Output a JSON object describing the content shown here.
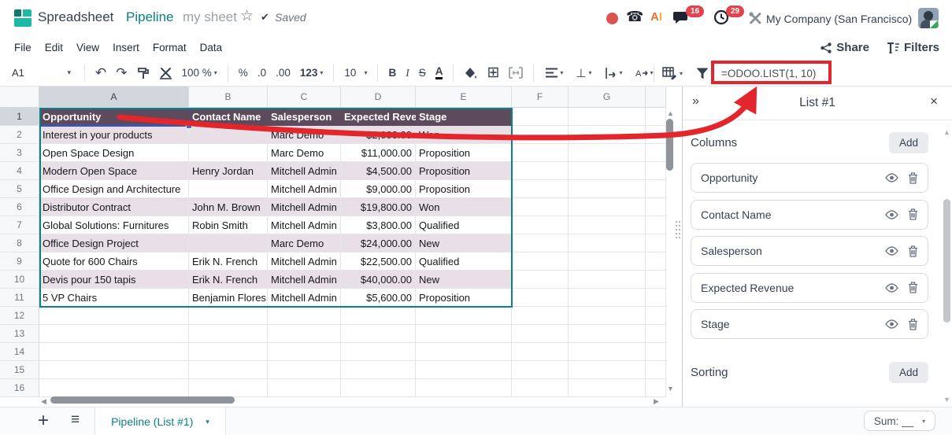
{
  "topbar": {
    "app_title": "Spreadsheet",
    "doc_title": "Pipeline",
    "doc_subtitle": "my sheet",
    "saved_label": "Saved",
    "company": "My Company (San Francisco)",
    "message_count": "16",
    "activity_count": "29"
  },
  "menubar": {
    "items": [
      "File",
      "Edit",
      "View",
      "Insert",
      "Format",
      "Data"
    ],
    "share_label": "Share",
    "filters_label": "Filters"
  },
  "toolbar": {
    "cell_ref": "A1",
    "zoom_label": "100 %",
    "percent_label": "%",
    "dec_less_label": ".0",
    "dec_more_label": ".00",
    "format_label": "123",
    "font_size": "10",
    "bold_label": "B",
    "italic_label": "I",
    "strike_label": "S",
    "color_label": "A",
    "formula": "=ODOO.LIST(1, 10)"
  },
  "grid": {
    "column_letters": [
      "A",
      "B",
      "C",
      "D",
      "E",
      "F",
      "G"
    ],
    "row_count": 16,
    "table": {
      "headers": [
        "Opportunity",
        "Contact Name",
        "Salesperson",
        "Expected Revenue",
        "Stage"
      ],
      "rows": [
        [
          "Interest in your products",
          "",
          "Marc Demo",
          "$2,000.00",
          "Won"
        ],
        [
          "Open Space Design",
          "",
          "Marc Demo",
          "$11,000.00",
          "Proposition"
        ],
        [
          "Modern Open Space",
          "Henry Jordan",
          "Mitchell Admin",
          "$4,500.00",
          "Proposition"
        ],
        [
          "Office Design and Architecture",
          "",
          "Mitchell Admin",
          "$9,000.00",
          "Proposition"
        ],
        [
          "Distributor Contract",
          "John M. Brown",
          "Mitchell Admin",
          "$19,800.00",
          "Won"
        ],
        [
          "Global Solutions: Furnitures",
          "Robin Smith",
          "Mitchell Admin",
          "$3,800.00",
          "Qualified"
        ],
        [
          "Office Design Project",
          "",
          "Marc Demo",
          "$24,000.00",
          "New"
        ],
        [
          "Quote for 600 Chairs",
          "Erik N. French",
          "Mitchell Admin",
          "$22,500.00",
          "Qualified"
        ],
        [
          "Devis pour 150 tapis",
          "Erik N. French",
          "Mitchell Admin",
          "$40,000.00",
          "New"
        ],
        [
          "5 VP Chairs",
          "Benjamin Flores",
          "Mitchell Admin",
          "$5,600.00",
          "Proposition"
        ]
      ]
    }
  },
  "panel": {
    "title": "List #1",
    "columns_section": {
      "label": "Columns",
      "add_label": "Add",
      "items": [
        "Opportunity",
        "Contact Name",
        "Salesperson",
        "Expected Revenue",
        "Stage"
      ]
    },
    "sorting_section": {
      "label": "Sorting",
      "add_label": "Add"
    }
  },
  "bottombar": {
    "sheet_tab": "Pipeline (List #1)",
    "sum_label": "Sum: __"
  },
  "icons": {
    "star": "☆",
    "check": "✔",
    "phone": "☎",
    "ai_a": "A",
    "ai_i": "I",
    "caret_down": "▾",
    "arrow_up": "▲",
    "arrow_down": "▼",
    "arrow_left": "◀",
    "arrow_right": "▶",
    "undo": "↶",
    "redo": "↷",
    "borders": "⊞",
    "valign": "⊥",
    "collapse": "»",
    "close": "×",
    "plus": "+",
    "hamburger": "≡"
  },
  "colors": {
    "brand_teal": "#0b7e86",
    "table_header_bg": "#5d4b5d",
    "table_row_alt_bg": "#e9dfe6",
    "selection_border": "#0c8084",
    "cell_selection": "#3d6ce5",
    "annotation_red": "#e2262b",
    "badge_red": "#e4424d"
  }
}
